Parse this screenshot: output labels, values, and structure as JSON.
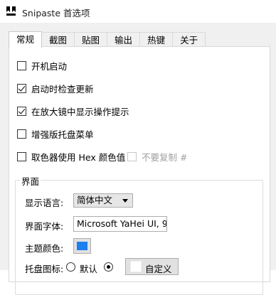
{
  "window": {
    "title": "Snipaste 首选项"
  },
  "tabs": [
    "常规",
    "截图",
    "贴图",
    "输出",
    "热键",
    "关于"
  ],
  "active_tab": "常规",
  "options": [
    {
      "label": "开机启动",
      "checked": false
    },
    {
      "label": "启动时检查更新",
      "checked": true
    },
    {
      "label": "在放大镜中显示操作提示",
      "checked": true
    },
    {
      "label": "增强版托盘菜单",
      "checked": false
    },
    {
      "label": "取色器使用 Hex 颜色值",
      "checked": false
    }
  ],
  "no_copy_hash": {
    "label": "不要复制 #",
    "checked": false,
    "enabled": false
  },
  "interface_group": {
    "title": "界面",
    "language_label": "显示语言:",
    "language_value": "简体中文",
    "font_label": "界面字体:",
    "font_value": "Microsoft YaHei UI, 9",
    "theme_color_label": "主题颜色:",
    "theme_color": "#1c7ff0",
    "tray_icon_label": "托盘图标:",
    "tray_default_label": "默认",
    "tray_default_selected": false,
    "tray_custom_selected": true,
    "tray_custom_button": "自定义"
  }
}
